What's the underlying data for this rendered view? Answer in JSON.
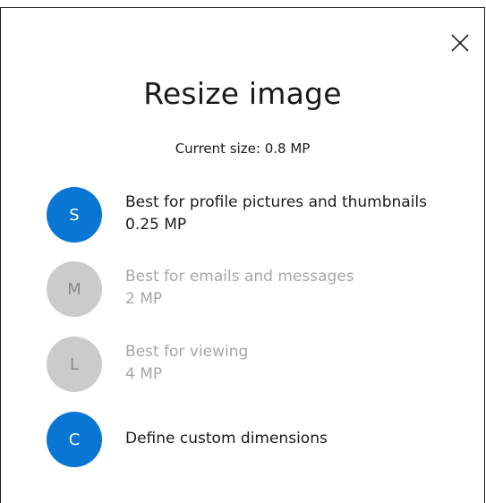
{
  "dialog": {
    "title": "Resize image",
    "current_size": "Current size: 0.8 MP",
    "close_glyph": "close-icon"
  },
  "options": [
    {
      "letter": "S",
      "label": "Best for profile pictures and thumbnails",
      "size": "0.25 MP",
      "enabled": true
    },
    {
      "letter": "M",
      "label": "Best for emails and messages",
      "size": "2 MP",
      "enabled": false
    },
    {
      "letter": "L",
      "label": "Best for viewing",
      "size": "4 MP",
      "enabled": false
    },
    {
      "letter": "C",
      "label": "Define custom dimensions",
      "enabled": true
    }
  ],
  "colors": {
    "accent": "#0a76d4",
    "disabled_circle": "#cbcbcb",
    "disabled_text": "#a6a6a6"
  }
}
